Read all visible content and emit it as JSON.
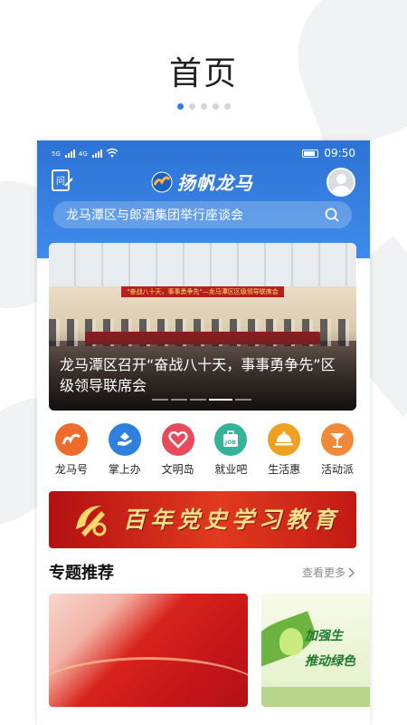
{
  "page": {
    "title": "首页",
    "dots_total": 5,
    "dots_active_index": 0
  },
  "status_bar": {
    "sim1_label": "5G",
    "sim2_label": "4G",
    "time": "09:50"
  },
  "header": {
    "logo_text": "扬帆龙马",
    "question_icon": "question-book-icon",
    "search_text": "龙马潭区与郎酒集团举行座谈会",
    "search_icon": "search-icon"
  },
  "banner": {
    "stage_text": "\"奋战八十天，事事勇争先\"—龙马潭区区级领导联席会",
    "caption": "龙马潭区召开“奋战八十天，事事勇争先”区级领导联席会",
    "slide_count": 5,
    "active_slide": 3
  },
  "quick_links": [
    {
      "label": "龙马号",
      "icon": "longma-logo-icon",
      "color": "#ef6b2c"
    },
    {
      "label": "掌上办",
      "icon": "hand-service-icon",
      "color": "#2f80de"
    },
    {
      "label": "文明岛",
      "icon": "heart-icon",
      "color": "#e94a5a"
    },
    {
      "label": "就业吧",
      "icon": "job-briefcase-icon",
      "color": "#33b39a"
    },
    {
      "label": "生活惠",
      "icon": "dish-cover-icon",
      "color": "#f0a020"
    },
    {
      "label": "活动派",
      "icon": "cocktail-icon",
      "color": "#ef8a3a"
    }
  ],
  "promo": {
    "text": "百年党史学习教育",
    "icon": "party-emblem-icon"
  },
  "topics": {
    "title": "专题推荐",
    "more_label": "查看更多",
    "more_icon": "chevron-right-icon",
    "card2_line1": "加强生",
    "card2_line2": "推动绿色"
  },
  "colors": {
    "brand_blue": "#2f7de1",
    "party_red": "#c4151a",
    "party_gold": "#ffde8a"
  }
}
